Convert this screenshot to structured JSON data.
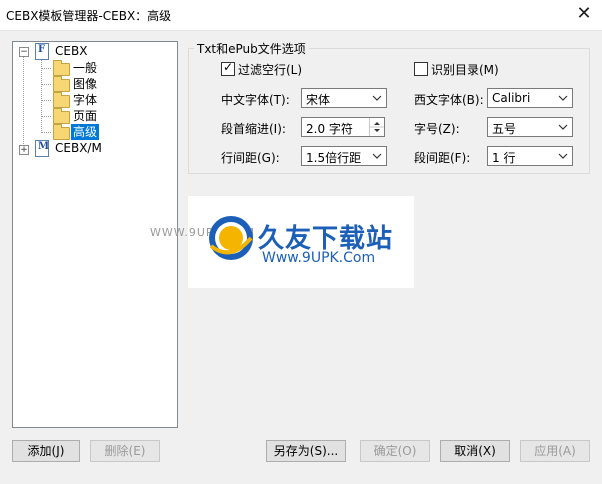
{
  "window": {
    "title": "CEBX模板管理器-CEBX：高级"
  },
  "tree": {
    "root1": {
      "label": "CEBX",
      "icon": "F"
    },
    "children": [
      {
        "label": "一般"
      },
      {
        "label": "图像"
      },
      {
        "label": "字体"
      },
      {
        "label": "页面"
      },
      {
        "label": "高级",
        "selected": true
      }
    ],
    "root2": {
      "label": "CEBX/M",
      "icon": "M"
    }
  },
  "options": {
    "group_title": "Txt和ePub文件选项",
    "filter_blank_lines": {
      "label": "过滤空行(L)",
      "checked": true
    },
    "recognize_toc": {
      "label": "识别目录(M)",
      "checked": false
    },
    "chinese_font": {
      "label": "中文字体(T):",
      "value": "宋体"
    },
    "western_font": {
      "label": "西文字体(B):",
      "value": "Calibri"
    },
    "indent": {
      "label": "段首缩进(I):",
      "value": "2.0 字符"
    },
    "font_size": {
      "label": "字号(Z):",
      "value": "五号"
    },
    "line_spacing": {
      "label": "行间距(G):",
      "value": "1.5倍行距"
    },
    "para_spacing": {
      "label": "段间距(F):",
      "value": "1 行"
    }
  },
  "watermark": {
    "brand": "久友下载站",
    "url": "Www.9UPK.Com",
    "side_text": "WWW.9UPK.COM"
  },
  "buttons": {
    "add": "添加(J)",
    "delete": "删除(E)",
    "save_as": "另存为(S)...",
    "ok": "确定(O)",
    "cancel": "取消(X)",
    "apply": "应用(A)"
  },
  "colors": {
    "selection": "#0078d7",
    "window_bg": "#f0f0f0"
  }
}
